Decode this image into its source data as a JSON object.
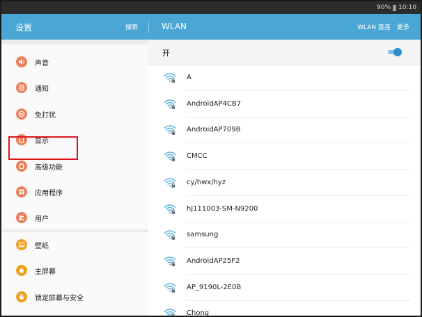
{
  "status": {
    "battery": "90%",
    "time": "10:10"
  },
  "header": {
    "title": "设置",
    "search": "搜索",
    "wlan_title": "WLAN",
    "wlan_direct": "WLAN 直连",
    "more": "更多"
  },
  "sidebar": {
    "items": [
      {
        "label": "声音",
        "icon": "speaker-icon",
        "color": "#e9805a"
      },
      {
        "label": "通知",
        "icon": "notification-icon",
        "color": "#e9805a"
      },
      {
        "label": "免打扰",
        "icon": "do-not-disturb-icon",
        "color": "#e9805a"
      },
      {
        "label": "显示",
        "icon": "display-icon",
        "color": "#e9805a"
      },
      {
        "label": "高级功能",
        "icon": "advanced-features-icon",
        "color": "#e9805a"
      },
      {
        "label": "应用程序",
        "icon": "apps-grid-icon",
        "color": "#e9805a"
      },
      {
        "label": "用户",
        "icon": "users-icon",
        "color": "#e9805a"
      },
      {
        "label": "壁纸",
        "icon": "wallpaper-icon",
        "color": "#f0a020"
      },
      {
        "label": "主屏幕",
        "icon": "home-icon",
        "color": "#f0a020"
      },
      {
        "label": "锁定屏幕与安全",
        "icon": "lock-icon",
        "color": "#f0a020"
      }
    ]
  },
  "wlan": {
    "toggle_label": "开",
    "enabled": true,
    "accent": "#2b8fd0",
    "networks": [
      {
        "name": "A"
      },
      {
        "name": "AndroidAP4CB7"
      },
      {
        "name": "AndroidAP709B"
      },
      {
        "name": "CMCC"
      },
      {
        "name": "cy/hwx/hyz"
      },
      {
        "name": "hj111003-SM-N9200"
      },
      {
        "name": "samsung"
      },
      {
        "name": "AndroidAP25F2"
      },
      {
        "name": "AP_9190L-2E0B"
      },
      {
        "name": "Chong"
      }
    ]
  }
}
